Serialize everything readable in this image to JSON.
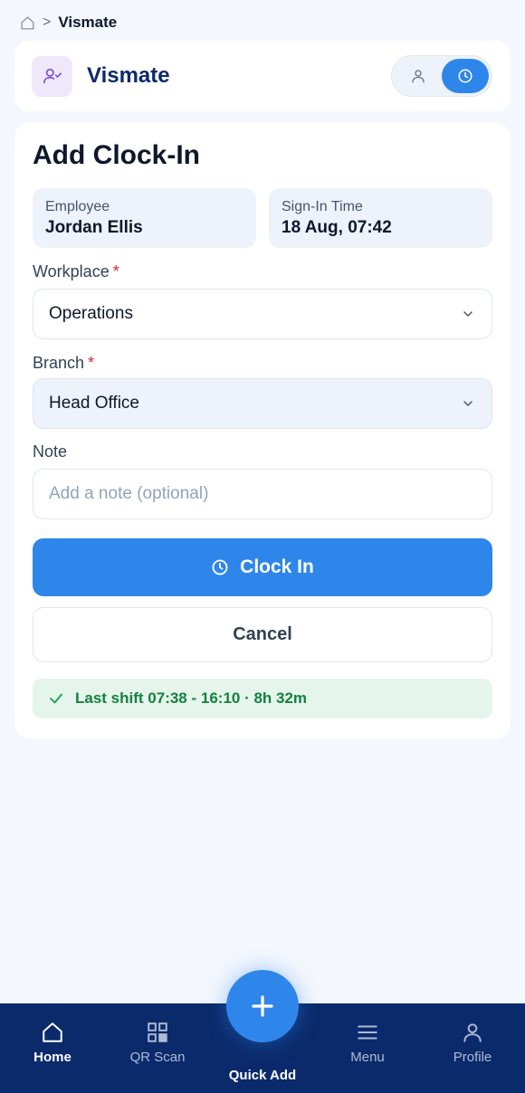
{
  "breadcrumb": {
    "separator": ">",
    "current": "Vismate"
  },
  "header": {
    "app_name": "Vismate",
    "logo_icon": "user-check-icon",
    "toggle": [
      "person-icon",
      "clock-icon"
    ]
  },
  "form": {
    "title": "Add Clock-In",
    "employee": {
      "label": "Employee",
      "value": "Jordan Ellis"
    },
    "sign_in_time": {
      "label": "Sign-In Time",
      "value": "18 Aug, 07:42"
    },
    "workplace": {
      "label": "Workplace",
      "required_mark": "*",
      "value": "Operations"
    },
    "branch": {
      "label": "Branch",
      "required_mark": "*",
      "value": "Head Office"
    },
    "note": {
      "label": "Note",
      "placeholder": "Add a note (optional)",
      "value": ""
    },
    "clock_in_label": "Clock In",
    "cancel_label": "Cancel",
    "last_shift": "Last shift 07:38 - 16:10 · 8h 32m"
  },
  "nav": {
    "items": [
      {
        "label": "Home",
        "icon": "home-icon",
        "active": true
      },
      {
        "label": "QR Scan",
        "icon": "qr-icon",
        "active": false
      },
      {
        "label": "Menu",
        "icon": "menu-icon",
        "active": false
      },
      {
        "label": "Profile",
        "icon": "profile-icon",
        "active": false
      }
    ],
    "quick_add_label": "Quick Add"
  },
  "colors": {
    "accent": "#2f86ea",
    "nav_bg": "#0b2a6b",
    "brand_text": "#0b2a6b",
    "success": "#15803d",
    "required": "#dc2626"
  }
}
